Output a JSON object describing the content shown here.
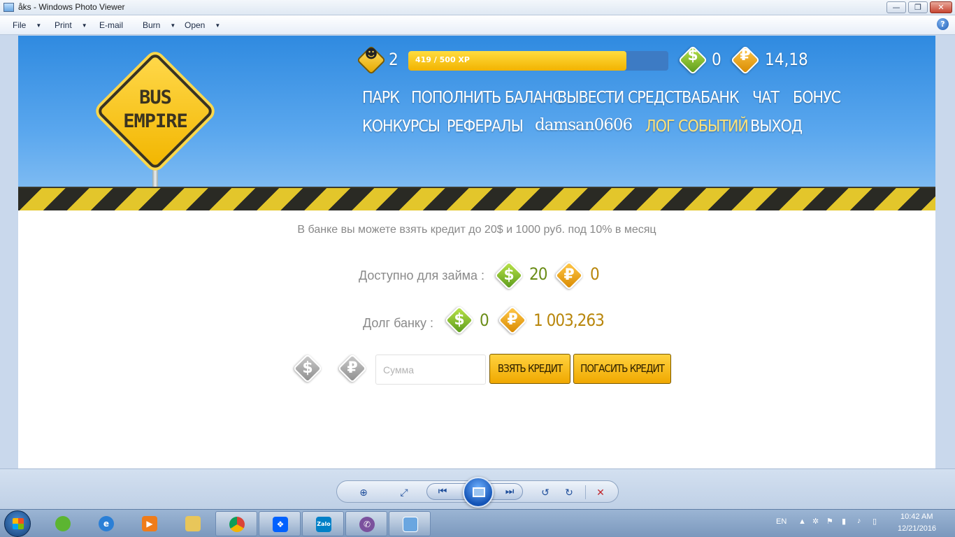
{
  "window": {
    "title": "åks - Windows Photo Viewer",
    "minimize_glyph": "—",
    "maximize_glyph": "❐",
    "close_glyph": "✕"
  },
  "menu": {
    "items": [
      {
        "label": "File"
      },
      {
        "label": "Print"
      },
      {
        "label": "E-mail"
      },
      {
        "label": "Burn"
      },
      {
        "label": "Open"
      }
    ],
    "help_glyph": "?"
  },
  "game": {
    "logo_line1": "BUS",
    "logo_line2": "EMPIRE",
    "level": "2",
    "xp_text": "419 / 500 XP",
    "xp_fraction": 0.838,
    "dollars": "0",
    "rubles": "14,18",
    "nav": {
      "park": "ПАРК",
      "topup": "ПОПОЛНИТЬ БАЛАНС",
      "withdraw": "ВЫВЕСТИ СРЕДСТВА",
      "bank": "БАНК",
      "chat": "ЧАТ",
      "bonus": "БОНУС",
      "contests": "КОНКУРСЫ",
      "referrals": "РЕФЕРАЛЫ",
      "username": "damsan0606",
      "event_log": "ЛОГ СОБЫТИЙ",
      "logout": "ВЫХОД"
    },
    "currency_glyphs": {
      "dollar": "$",
      "ruble": "₽"
    }
  },
  "bank": {
    "info": "В банке вы можете взять кредит до 20$ и 1000 руб. под 10% в месяц",
    "available_label": "Доступно для займа :",
    "available_dollars": "20",
    "available_rubles": "0",
    "debt_label": "Долг банку :",
    "debt_dollars": "0",
    "debt_rubles": "1 003,263",
    "amount_placeholder": "Сумма",
    "take_credit": "ВЗЯТЬ КРЕДИТ",
    "repay_credit": "ПОГАСИТЬ КРЕДИТ"
  },
  "viewer_toolbar": {
    "zoom_glyph": "⊕",
    "fit_glyph": "⤢",
    "prev_glyph": "⏮",
    "next_glyph": "⏭",
    "rotate_ccw_glyph": "↺",
    "rotate_cw_glyph": "↻",
    "delete_glyph": "✕"
  },
  "taskbar": {
    "language": "EN",
    "time": "10:42 AM",
    "date": "12/21/2016",
    "zalo_label": "Zalo"
  },
  "colors": {
    "header_blue": "#2f8ae0",
    "accent_yellow": "#f2b300",
    "active_nav": "#ffe37a"
  }
}
